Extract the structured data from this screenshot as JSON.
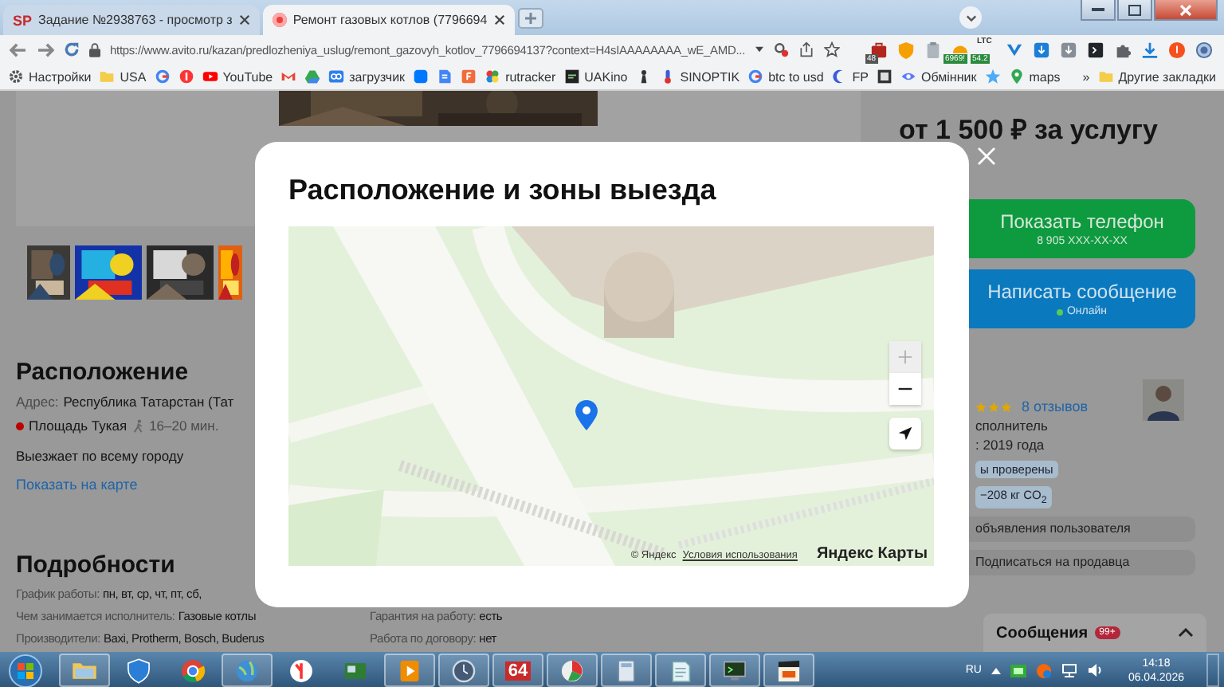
{
  "browser": {
    "tabs": [
      {
        "favicon_text": "SP",
        "title": "Задание №2938763 - просмотр з",
        "selected": false
      },
      {
        "title": "Ремонт газовых котлов (7796694",
        "selected": true
      }
    ],
    "url": "https://www.avito.ru/kazan/predlozheniya_uslug/remont_gazovyh_kotlov_7796694137?context=H4sIAAAAAAAA_wE_AMD...",
    "extensions": [
      {
        "kind": "briefcase",
        "badge": "48"
      },
      {
        "kind": "shield"
      },
      {
        "kind": "clipboard"
      },
      {
        "kind": "gauge",
        "badge": "6969!"
      },
      {
        "kind": "coin",
        "caption": "LTC",
        "badge": "54.2"
      },
      {
        "kind": "chevron"
      },
      {
        "kind": "download-blue"
      },
      {
        "kind": "download-gray"
      },
      {
        "kind": "terminal"
      },
      {
        "kind": "puzzle"
      },
      {
        "kind": "download"
      },
      {
        "kind": "profile"
      },
      {
        "kind": "globe"
      }
    ],
    "bookmarks": [
      {
        "kind": "gear",
        "label": "Настройки"
      },
      {
        "kind": "folder",
        "label": "USA"
      },
      {
        "kind": "g"
      },
      {
        "kind": "ya"
      },
      {
        "kind": "youtube",
        "label": "YouTube"
      },
      {
        "kind": "mail"
      },
      {
        "kind": "drive"
      },
      {
        "kind": "loop",
        "label": "загрузчик"
      },
      {
        "kind": "vk"
      },
      {
        "kind": "docs"
      },
      {
        "kind": "f"
      },
      {
        "kind": "pinwheel",
        "label": "rutracker"
      },
      {
        "kind": "film",
        "label": "UAKino"
      },
      {
        "kind": "figure"
      },
      {
        "kind": "thermometer",
        "label": "SINOPTIK"
      },
      {
        "kind": "g",
        "label": "btc to usd"
      },
      {
        "kind": "moon",
        "label": "FP"
      },
      {
        "kind": "dark"
      },
      {
        "kind": "eye",
        "label": "Обмінник"
      },
      {
        "kind": "star"
      },
      {
        "kind": "pin",
        "label": "maps"
      }
    ],
    "more": "»",
    "other_bookmarks": "Другие закладки"
  },
  "page": {
    "location": {
      "heading": "Расположение",
      "address_label": "Адрес:",
      "address": "Республика Татарстан (Тат",
      "metro_station": "Площадь Тукая",
      "walk_time": "16–20 мин.",
      "travel_note": "Выезжает по всему городу",
      "map_link": "Показать на карте"
    },
    "details": {
      "heading": "Подробности",
      "rows": [
        {
          "items": [
            {
              "label": "График работы:",
              "value": "пн, вт, ср, чт, пт, сб,"
            }
          ]
        },
        {
          "items": [
            {
              "label": "Чем занимается исполнитель:",
              "value": "Газовые котлы"
            },
            {
              "label": "Гарантия на работу:",
              "value": "есть"
            }
          ]
        },
        {
          "items": [
            {
              "label": "Производители:",
              "value": "Baxi, Protherm, Bosch, Buderus"
            },
            {
              "label": "Работа по договору:",
              "value": "нет"
            }
          ]
        }
      ]
    },
    "sidebar": {
      "price": "от 1 500 ₽ за услугу",
      "phone_button": {
        "label": "Показать телефон",
        "sublabel": "8 905 XXX-XX-XX"
      },
      "message_button": {
        "label": "Написать сообщение",
        "status": "Онлайн",
        "online": true
      },
      "seller": {
        "stars": 3,
        "reviews": "8 отзывов",
        "role": "сполнитель",
        "since": ": 2019 года",
        "badges": [
          "ы проверены",
          "−208 кг CO$_{2}$"
        ],
        "actions": [
          "объявления пользователя",
          "Подписаться на продавца"
        ]
      }
    },
    "messages": {
      "label": "Сообщения",
      "badge": "99+"
    }
  },
  "modal": {
    "title": "Расположение и зоны выезда",
    "map": {
      "kind": "picture",
      "controls": [
        {
          "kind": "zoom-in",
          "disabled": true
        },
        {
          "kind": "zoom-out",
          "disabled": false
        },
        {
          "kind": "locate",
          "disabled": false
        }
      ],
      "copyright": "© Яндекс",
      "terms_link": "Условия использования",
      "logo": "Яндекс Карты"
    }
  },
  "taskbar": {
    "apps": [
      {
        "kind": "folder",
        "running": true
      },
      {
        "kind": "shield",
        "running": false
      },
      {
        "kind": "chrome",
        "running": false
      },
      {
        "kind": "globe",
        "running": true
      },
      {
        "kind": "ya",
        "running": false
      },
      {
        "kind": "card",
        "running": false
      },
      {
        "kind": "play",
        "running": true
      },
      {
        "kind": "clock",
        "running": true
      },
      {
        "kind": "number",
        "label": "64",
        "running": true
      },
      {
        "kind": "pie",
        "running": true
      },
      {
        "kind": "calc",
        "running": true
      },
      {
        "kind": "notepad",
        "running": true
      },
      {
        "kind": "monitor",
        "running": true
      },
      {
        "kind": "clapper",
        "running": true
      }
    ],
    "language": "RU",
    "time": "14:18",
    "date": "06.04.2026"
  }
}
